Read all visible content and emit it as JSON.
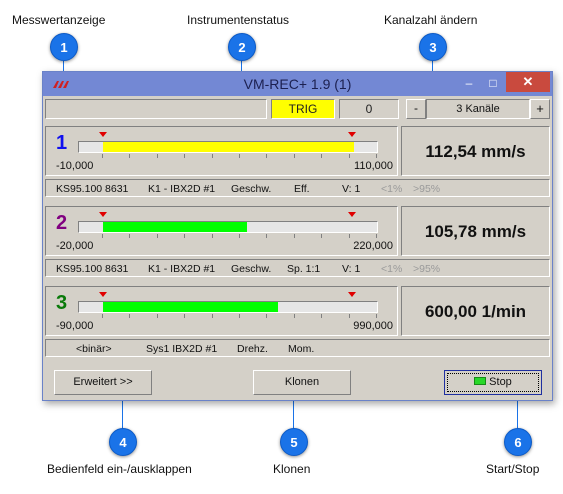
{
  "callouts": [
    {
      "num": "1",
      "label": "Messwertanzeige"
    },
    {
      "num": "2",
      "label": "Instrumentenstatus"
    },
    {
      "num": "3",
      "label": "Kanalzahl ändern"
    },
    {
      "num": "4",
      "label": "Bedienfeld ein-/ausklappen"
    },
    {
      "num": "5",
      "label": "Klonen"
    },
    {
      "num": "6",
      "label": "Start/Stop"
    }
  ],
  "window": {
    "title": "VM-REC+ 1.9 (1)",
    "minimize_label": "–",
    "maximize_label": "□",
    "close_label": "✕"
  },
  "status": {
    "field": "",
    "trigger_label": "TRIG",
    "count_value": "0",
    "minus_label": "-",
    "channel_count_label": "3 Kanäle",
    "plus_label": "+"
  },
  "channels": [
    {
      "number": "1",
      "number_color": "#1010ee",
      "bar_color": "#ffff00",
      "fill_fraction": 0.917,
      "range_min": "-10,000",
      "range_max": "110,000",
      "value": "112,54 mm/s",
      "info": [
        "KS95.100 8631",
        "K1 - IBX2D #1",
        "Geschw.",
        "Eff.",
        "V: 1",
        "<1%",
        ">95%"
      ]
    },
    {
      "number": "2",
      "number_color": "#800080",
      "bar_color": "#00ff00",
      "fill_fraction": 0.525,
      "range_min": "-20,000",
      "range_max": "220,000",
      "value": "105,78 mm/s",
      "info": [
        "KS95.100 8631",
        "K1 - IBX2D #1",
        "Geschw.",
        "Sp. 1:1",
        "V: 1",
        "<1%",
        ">95%"
      ]
    },
    {
      "number": "3",
      "number_color": "#0a7a0a",
      "bar_color": "#00ff00",
      "fill_fraction": 0.64,
      "range_min": "-90,000",
      "range_max": "990,000",
      "value": "600,00 1/min",
      "info": [
        "<binär>",
        "Sys1 IBX2D #1",
        "Drehz.",
        "Mom."
      ]
    }
  ],
  "footer": {
    "expand_label": "Erweitert >>",
    "clone_label": "Klonen",
    "stop_label": "Stop"
  }
}
